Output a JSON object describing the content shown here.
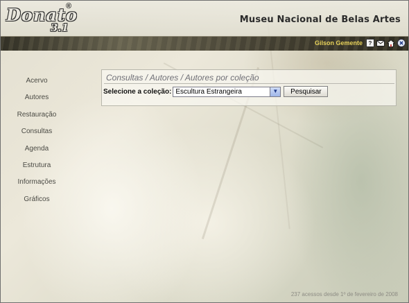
{
  "header": {
    "logo_main": "Donato",
    "logo_version": "3.1",
    "logo_mark": "®",
    "museum_title": "Museu Nacional de Belas Artes"
  },
  "userbar": {
    "user_name": "Gilson Gemente",
    "icons": [
      "help-icon",
      "mail-icon",
      "home-icon",
      "logout-icon"
    ],
    "help_glyph": "?"
  },
  "sidebar": {
    "items": [
      {
        "label": "Acervo"
      },
      {
        "label": "Autores"
      },
      {
        "label": "Restauração"
      },
      {
        "label": "Consultas"
      },
      {
        "label": "Agenda"
      },
      {
        "label": "Estrutura"
      },
      {
        "label": "Informações"
      },
      {
        "label": "Gráficos"
      }
    ]
  },
  "content": {
    "breadcrumb": "Consultas / Autores / Autores por coleção",
    "collection_label": "Selecione a coleção:",
    "collection_selected": "Escultura Estrangeira",
    "search_button": "Pesquisar"
  },
  "footer": {
    "note": "237 acessos desde 1º de fevereiro de 2008"
  },
  "colors": {
    "username": "#e8d25a",
    "breadcrumb": "#6f6f76",
    "nav_text": "#4a4a44"
  }
}
